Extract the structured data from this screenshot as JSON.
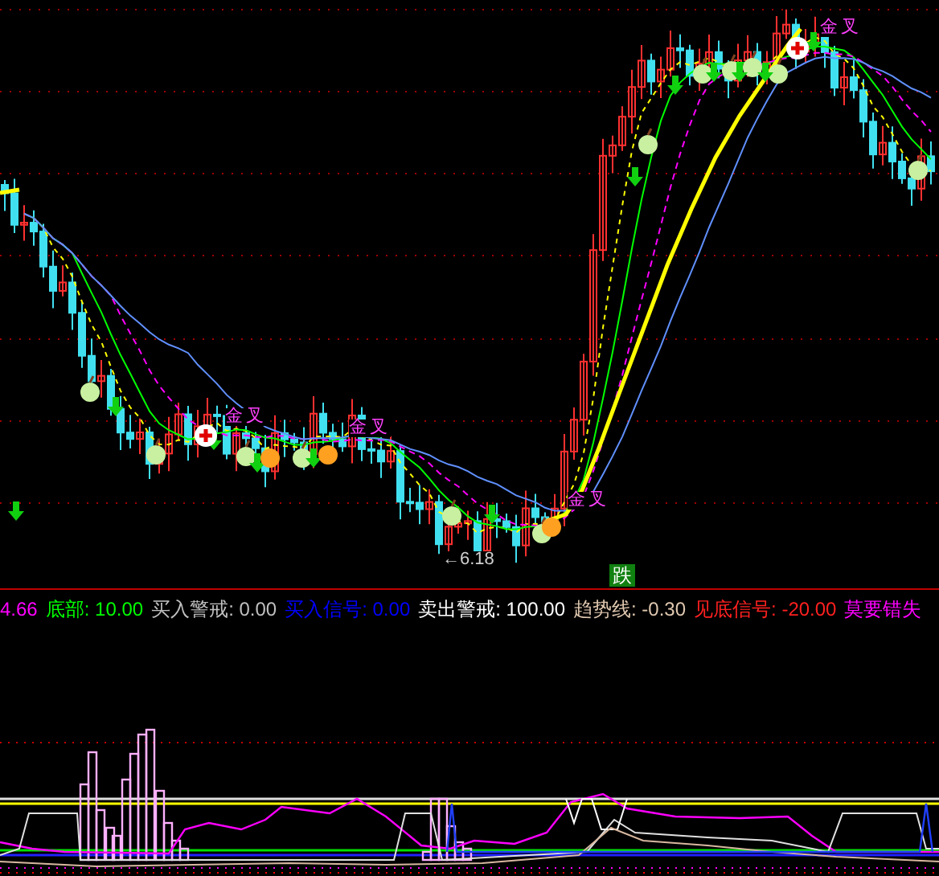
{
  "main_chart": {
    "cross_labels": [
      "金叉",
      "金叉",
      "金叉",
      "金叉"
    ],
    "low_price_label": "←6.18",
    "signal_badge": "跌"
  },
  "indicator_bar": {
    "items": [
      {
        "value": "4.66",
        "color": "#ff00ff"
      },
      {
        "label": "底部:",
        "value": "10.00",
        "color": "#00ff00"
      },
      {
        "label": "买入警戒:",
        "value": "0.00",
        "color": "#c0c0c0"
      },
      {
        "label": "买入信号:",
        "value": "0.00",
        "color": "#0000ff"
      },
      {
        "label": "卖出警戒:",
        "value": "100.00",
        "color": "#ffffff"
      },
      {
        "label": "趋势线:",
        "value": "-0.30",
        "color": "#e0c8b0"
      },
      {
        "label": "见底信号:",
        "value": "-20.00",
        "color": "#ff2020"
      },
      {
        "label": "莫要错失",
        "color": "#ff00ff"
      }
    ]
  }
}
